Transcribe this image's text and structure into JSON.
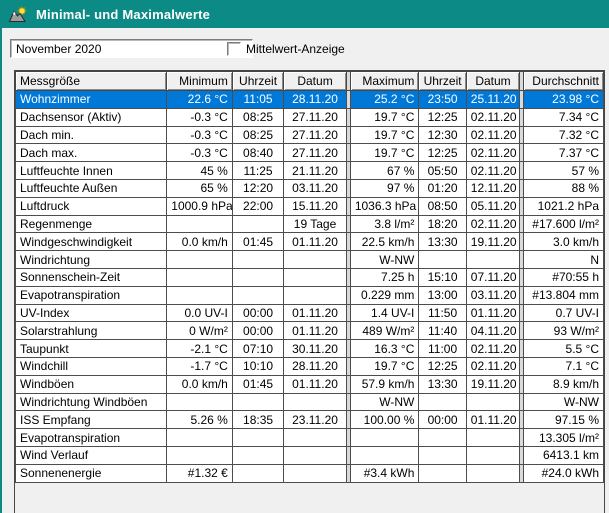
{
  "window": {
    "title": "Minimal- und Maximalwerte"
  },
  "controls": {
    "period_value": "November 2020",
    "checkbox_label": "Mittelwert-Anzeige",
    "checkbox_checked": false
  },
  "colors": {
    "titlebar_teal": "#0b8a86",
    "selection_blue": "#0078d7",
    "window_background": "#f0f0f0",
    "grid_line": "#4d4d4d"
  },
  "icons": {
    "app_icon": "weather-station-sun-icon"
  },
  "table": {
    "headers": [
      "Messgröße",
      "Minimum",
      "Uhrzeit",
      "Datum",
      "Maximum",
      "Uhrzeit",
      "Datum",
      "Durchschnitt"
    ],
    "selected_row_index": 0,
    "rows": [
      [
        "Wohnzimmer",
        "22.6 °C",
        "11:05",
        "28.11.20",
        "25.2 °C",
        "23:50",
        "25.11.20",
        "23.98 °C"
      ],
      [
        "Dachsensor (Aktiv)",
        "-0.3 °C",
        "08:25",
        "27.11.20",
        "19.7 °C",
        "12:25",
        "02.11.20",
        "7.34 °C"
      ],
      [
        "Dach min.",
        "-0.3 °C",
        "08:25",
        "27.11.20",
        "19.7 °C",
        "12:30",
        "02.11.20",
        "7.32 °C"
      ],
      [
        "Dach max.",
        "-0.3 °C",
        "08:40",
        "27.11.20",
        "19.7 °C",
        "12:25",
        "02.11.20",
        "7.37 °C"
      ],
      [
        "Luftfeuchte Innen",
        "45 %",
        "11:25",
        "21.11.20",
        "67 %",
        "05:50",
        "02.11.20",
        "57 %"
      ],
      [
        "Luftfeuchte Außen",
        "65 %",
        "12:20",
        "03.11.20",
        "97 %",
        "01:20",
        "12.11.20",
        "88 %"
      ],
      [
        "Luftdruck",
        "1000.9 hPa",
        "22:00",
        "15.11.20",
        "1036.3 hPa",
        "08:50",
        "05.11.20",
        "1021.2 hPa"
      ],
      [
        "Regenmenge",
        "",
        "",
        "19 Tage",
        "3.8 l/m²",
        "18:20",
        "02.11.20",
        "#17.600 l/m²"
      ],
      [
        "Windgeschwindigkeit",
        "0.0 km/h",
        "01:45",
        "01.11.20",
        "22.5 km/h",
        "13:30",
        "19.11.20",
        "3.0 km/h"
      ],
      [
        "Windrichtung",
        "",
        "",
        "",
        "W-NW",
        "",
        "",
        "N"
      ],
      [
        "Sonnenschein-Zeit",
        "",
        "",
        "",
        "7.25 h",
        "15:10",
        "07.11.20",
        "#70:55 h"
      ],
      [
        "Evapotranspiration",
        "",
        "",
        "",
        "0.229 mm",
        "13:00",
        "03.11.20",
        "#13.804 mm"
      ],
      [
        "UV-Index",
        "0.0 UV-I",
        "00:00",
        "01.11.20",
        "1.4 UV-I",
        "11:50",
        "01.11.20",
        "0.7 UV-I"
      ],
      [
        "Solarstrahlung",
        "0 W/m²",
        "00:00",
        "01.11.20",
        "489 W/m²",
        "11:40",
        "04.11.20",
        "93 W/m²"
      ],
      [
        "Taupunkt",
        "-2.1 °C",
        "07:10",
        "30.11.20",
        "16.3 °C",
        "11:00",
        "02.11.20",
        "5.5 °C"
      ],
      [
        "Windchill",
        "-1.7 °C",
        "10:10",
        "28.11.20",
        "19.7 °C",
        "12:25",
        "02.11.20",
        "7.1 °C"
      ],
      [
        "Windböen",
        "0.0 km/h",
        "01:45",
        "01.11.20",
        "57.9 km/h",
        "13:30",
        "19.11.20",
        "8.9 km/h"
      ],
      [
        "Windrichtung Windböen",
        "",
        "",
        "",
        "W-NW",
        "",
        "",
        "W-NW"
      ],
      [
        "ISS Empfang",
        "5.26 %",
        "18:35",
        "23.11.20",
        "100.00 %",
        "00:00",
        "01.11.20",
        "97.15 %"
      ],
      [
        "Evapotranspiration",
        "",
        "",
        "",
        "",
        "",
        "",
        "13.305 l/m²"
      ],
      [
        "Wind Verlauf",
        "",
        "",
        "",
        "",
        "",
        "",
        "6413.1 km"
      ],
      [
        "Sonnenenergie",
        "#1.32 €",
        "",
        "",
        "#3.4 kWh",
        "",
        "",
        "#24.0 kWh"
      ]
    ]
  }
}
